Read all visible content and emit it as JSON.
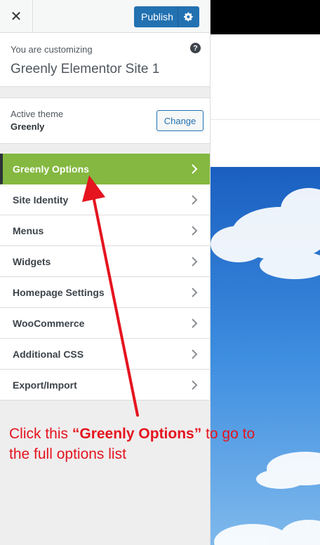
{
  "topbar": {
    "close_glyph": "✕",
    "publish_label": "Publish"
  },
  "info": {
    "customizing_label": "You are customizing",
    "site_title": "Greenly Elementor Site 1",
    "help_glyph": "?"
  },
  "theme": {
    "active_label": "Active theme",
    "name": "Greenly",
    "change_label": "Change"
  },
  "menu": {
    "items": [
      {
        "label": "Greenly Options",
        "active": true
      },
      {
        "label": "Site Identity",
        "active": false
      },
      {
        "label": "Menus",
        "active": false
      },
      {
        "label": "Widgets",
        "active": false
      },
      {
        "label": "Homepage Settings",
        "active": false
      },
      {
        "label": "WooCommerce",
        "active": false
      },
      {
        "label": "Additional CSS",
        "active": false
      },
      {
        "label": "Export/Import",
        "active": false
      }
    ]
  },
  "annotation": {
    "prefix": "Click this ",
    "highlight": "“Greenly Options”",
    "suffix": " to go to the full options list",
    "color": "#e5141f"
  },
  "colors": {
    "accent_green": "#84b840",
    "publish_blue": "#2271b1"
  }
}
